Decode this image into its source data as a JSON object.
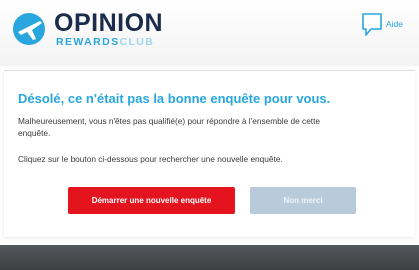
{
  "brand": {
    "name": "OPINION",
    "sub_rewards": "REWARDS",
    "sub_club": "CLUB",
    "logo_icon": "airplane-globe-icon"
  },
  "help": {
    "label": "Aide",
    "icon": "speech-bubble-icon"
  },
  "message": {
    "title": "Désolé, ce n'était pas la bonne enquête pour vous.",
    "paragraph1": "Malheureusement, vous n'êtes pas qualifié(e) pour répondre à l'ensemble de cette enquête.",
    "paragraph2": "Cliquez sur le bouton ci-dessous pour rechercher une nouvelle enquête."
  },
  "buttons": {
    "start_label": "Démarrer une nouvelle enquête",
    "decline_label": "Non merci"
  },
  "colors": {
    "accent": "#29a6de",
    "brand_dark": "#1a2b4c",
    "primary_button": "#e3141d",
    "secondary_button": "#b9cbdb",
    "footer": "#4a4d50"
  }
}
